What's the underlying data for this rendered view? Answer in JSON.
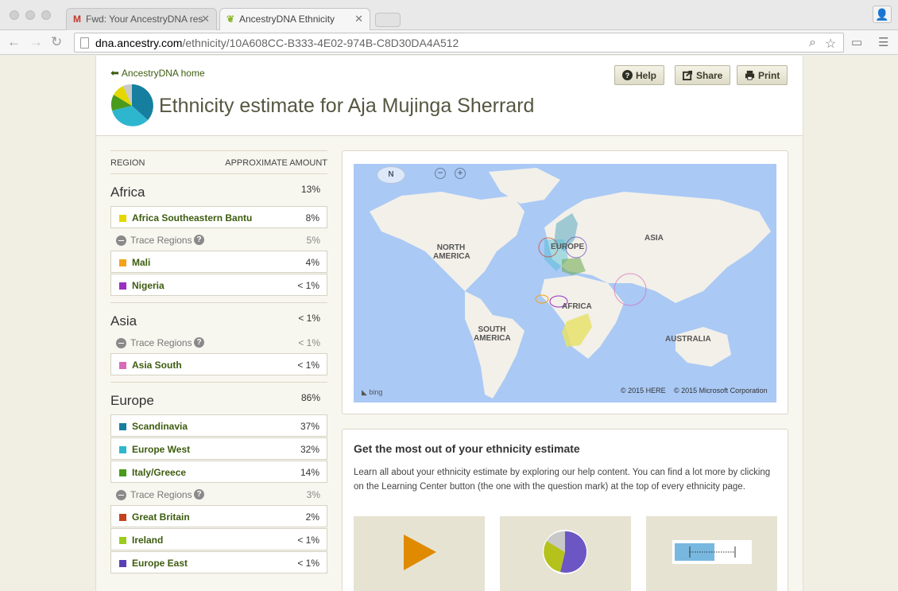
{
  "browser": {
    "tabs": [
      {
        "label": "Fwd: Your AncestryDNA res",
        "icon": "gmail-icon",
        "icon_color": "#c5372c",
        "active": false
      },
      {
        "label": "AncestryDNA Ethnicity",
        "icon": "ancestry-leaf-icon",
        "icon_color": "#8bb42b",
        "active": true
      }
    ],
    "url_host": "dna.ancestry.com",
    "url_path": "/ethnicity/10A608CC-B333-4E02-974B-C8D30DA4A512"
  },
  "header": {
    "home_link": "AncestryDNA home",
    "title": "Ethnicity estimate for Aja Mujinga Sherrard",
    "buttons": {
      "help": "Help",
      "share": "Share",
      "print": "Print"
    }
  },
  "regions": {
    "col_region": "REGION",
    "col_amount": "APPROXIMATE AMOUNT",
    "trace_label": "Trace Regions",
    "trace_help": "?",
    "africa": {
      "name": "Africa",
      "pct": "13%",
      "items": [
        {
          "name": "Africa Southeastern Bantu",
          "pct": "8%",
          "color": "#e5d800"
        },
        {
          "name": "Mali",
          "pct": "4%",
          "color": "#f3a21b"
        },
        {
          "name": "Nigeria",
          "pct": "< 1%",
          "color": "#9a2fc0"
        }
      ],
      "trace_pct": "5%"
    },
    "asia": {
      "name": "Asia",
      "pct": "< 1%",
      "items": [
        {
          "name": "Asia South",
          "pct": "< 1%",
          "color": "#d96ab8"
        }
      ],
      "trace_pct": "< 1%"
    },
    "europe": {
      "name": "Europe",
      "pct": "86%",
      "items": [
        {
          "name": "Scandinavia",
          "pct": "37%",
          "color": "#167fa0"
        },
        {
          "name": "Europe West",
          "pct": "32%",
          "color": "#2fb6cf"
        },
        {
          "name": "Italy/Greece",
          "pct": "14%",
          "color": "#4a9a1c"
        },
        {
          "name": "Great Britain",
          "pct": "2%",
          "color": "#c2441d"
        },
        {
          "name": "Ireland",
          "pct": "< 1%",
          "color": "#9bcb1c"
        },
        {
          "name": "Europe East",
          "pct": "< 1%",
          "color": "#5b3fb5"
        }
      ],
      "trace_pct": "3%"
    }
  },
  "map": {
    "labels": {
      "north_america": "NORTH\nAMERICA",
      "europe": "EUROPE",
      "asia": "ASIA",
      "africa": "AFRICA",
      "south_america": "SOUTH\nAMERICA",
      "australia": "AUSTRALIA"
    },
    "compass": "N",
    "copyright_here": "© 2015 HERE",
    "copyright_ms": "© 2015 Microsoft Corporation",
    "bing": "bing"
  },
  "info": {
    "title": "Get the most out of your ethnicity estimate",
    "text": "Learn all about your ethnicity estimate by exploring our help content. You can find a lot more by clicking on the Learning Center button (the one with the question mark) at the top of every ethnicity page."
  }
}
